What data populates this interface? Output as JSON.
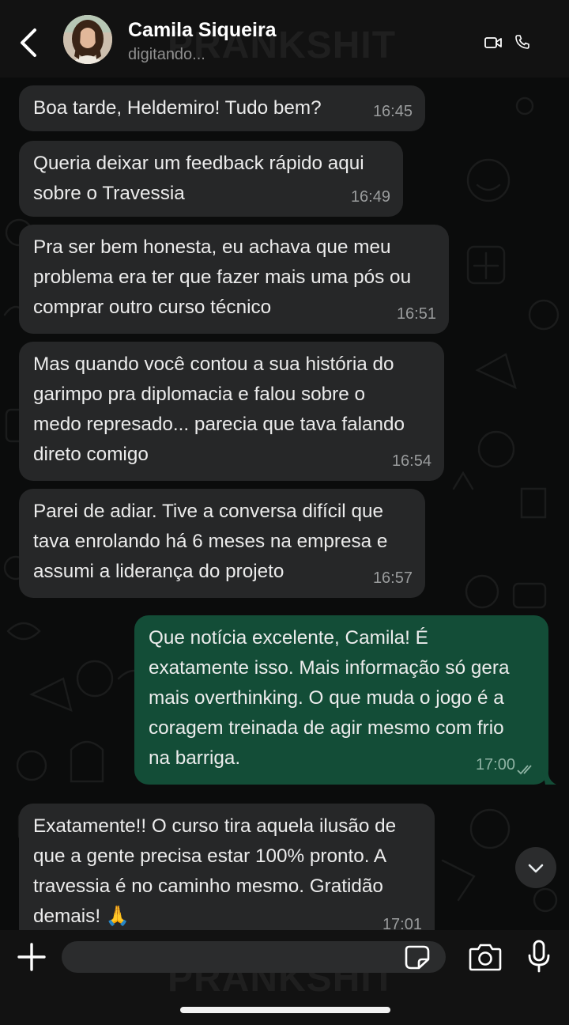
{
  "header": {
    "contact_name": "Camila Siqueira",
    "status": "digitando...",
    "icons": [
      "back-arrow-icon",
      "video-camera-icon",
      "phone-icon"
    ]
  },
  "watermark": "PRANKSHIT",
  "messages": [
    {
      "direction": "incoming",
      "text": "Boa tarde, Heldemiro! Tudo bem?",
      "time": "16:45"
    },
    {
      "direction": "incoming",
      "text": "Queria deixar um feedback rápido aqui\nsobre o Travessia",
      "time": "16:49"
    },
    {
      "direction": "incoming",
      "text": "Pra ser bem honesta, eu achava que meu\nproblema era ter que fazer mais uma pós ou\ncomprar outro curso técnico",
      "time": "16:51"
    },
    {
      "direction": "incoming",
      "text": "Mas quando você contou a sua história do\ngarimpo pra diplomacia e falou sobre o\nmedo represado... parecia que tava falando\ndireto comigo",
      "time": "16:54"
    },
    {
      "direction": "incoming",
      "text": "Parei de adiar. Tive a conversa difícil que\ntava enrolando há 6 meses na empresa e\nassumi a liderança do projeto",
      "time": "16:57"
    },
    {
      "direction": "outgoing",
      "text": "Que notícia excelente, Camila! É\nexatamente isso. Mais informação só gera\nmais overthinking. O que muda o jogo é a\ncoragem treinada de agir mesmo com frio\nna barriga.",
      "time": "17:00",
      "status": "read"
    },
    {
      "direction": "incoming",
      "text": "Exatamente!! O curso tira aquela ilusão de\nque a gente precisa estar 100% pronto. A\ntravessia é no caminho mesmo. Gratidão\ndemais! 🙏",
      "time": "17:01"
    }
  ],
  "composer": {
    "placeholder": "",
    "icons": [
      "plus-icon",
      "sticker-icon",
      "camera-icon",
      "microphone-icon"
    ]
  },
  "colors": {
    "background": "#0b0c0c",
    "incoming_bubble": "#262728",
    "outgoing_bubble": "#134d37",
    "header": "#121212"
  }
}
